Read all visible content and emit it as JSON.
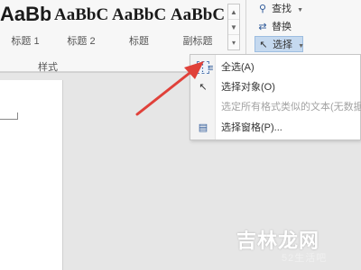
{
  "ribbon": {
    "styles": [
      {
        "preview": "AaBb",
        "label": "标题 1"
      },
      {
        "preview": "AaBbC",
        "label": "标题 2"
      },
      {
        "preview": "AaBbC",
        "label": "标题"
      },
      {
        "preview": "AaBbC",
        "label": "副标题"
      }
    ],
    "styles_group_label": "样式",
    "find_label": "查找",
    "replace_label": "替换",
    "select_label": "选择"
  },
  "select_menu": {
    "items": [
      {
        "label": "全选(A)",
        "icon": "select-all-icon",
        "enabled": true
      },
      {
        "label": "选择对象(O)",
        "icon": "select-objects-icon",
        "enabled": true
      },
      {
        "label": "选定所有格式类似的文本(无数据)",
        "icon": "",
        "enabled": false
      },
      {
        "label": "选择窗格(P)...",
        "icon": "selection-pane-icon",
        "enabled": true
      }
    ]
  },
  "colors": {
    "accent": "#2b5797",
    "arrow": "#e0413a",
    "active_button": "#c5d9ef"
  },
  "watermark": {
    "title": "吉林龙网",
    "sub": "52生活吧"
  }
}
